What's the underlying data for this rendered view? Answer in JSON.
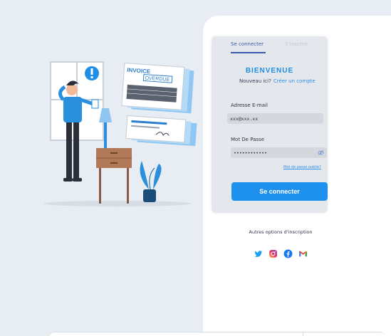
{
  "tabs": {
    "login": "Se connecter",
    "signup": "S'inscrire"
  },
  "card": {
    "title": "BIENVENUE",
    "new_prompt": "Nouveau ici?",
    "create_link": "Créer un compte",
    "email_label": "Adresse E-mail",
    "email_value": "xxx@xxx.xx",
    "password_label": "Mot De Passe",
    "password_value": "••••••••••••",
    "forgot_link": "Mot de passe oublié?",
    "submit_label": "Se connecter"
  },
  "other_options": "Autres options d'inscription",
  "socials": [
    "twitter-icon",
    "instagram-icon",
    "facebook-icon",
    "gmail-icon"
  ],
  "illustration": {
    "invoice": "INVOICE",
    "overdue": "OVERDUE"
  },
  "colors": {
    "accent": "#1e90ee",
    "tab_active": "#3a5aa8",
    "bg": "#e8edf3"
  }
}
